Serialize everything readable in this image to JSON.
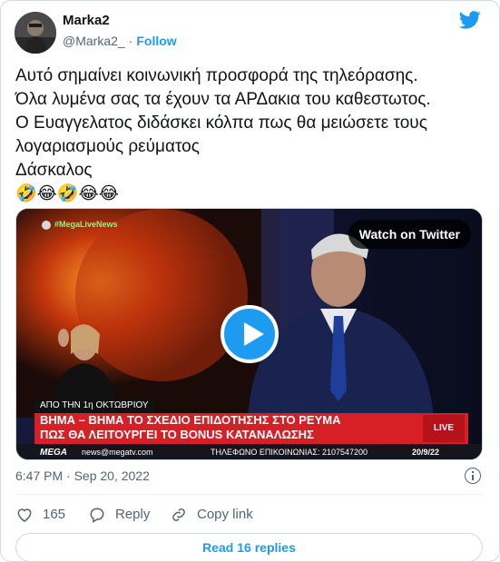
{
  "author": {
    "name": "Marka2",
    "handle": "@Marka2_",
    "follow_label": "Follow"
  },
  "tweet": {
    "lines": [
      "Αυτό σημαίνει κοινωνική προσφορά της τηλεόρασης.",
      "Όλα λυμένα σας τα έχουν τα ΑΡΔακια του καθεστωτος.",
      "Ο Ευαγγελατος διδάσκει κόλπα πως θα μειώσετε τους",
      "λογαριασμούς ρεύματος",
      "Δάσκαλος"
    ],
    "emojis": "🤣😂🤣😂😂"
  },
  "media": {
    "watch_label": "Watch on Twitter",
    "channel_tag": "#MegaLiveNews",
    "ticker_date": "ΑΠΟ ΤΗΝ 1η ΟΚΤΩΒΡΙΟΥ",
    "ticker_line1": "ΒΗΜΑ – ΒΗΜΑ ΤΟ ΣΧΕΔΙΟ ΕΠΙΔΟΤΗΣΗΣ ΣΤΟ ΡΕΥΜΑ",
    "ticker_line2": "ΠΩΣ ΘΑ ΛΕΙΤΟΥΡΓΕΙ ΤΟ BONUS ΚΑΤΑΝΑΛΩΣΗΣ",
    "badge": "LIVE NEWS",
    "footer_brand": "MEGA",
    "footer_site": "news@megatv.com",
    "footer_phone": "ΤΗΛΕΦΩΝΟ ΕΠΙΚΟΙΝΩΝΙΑΣ: 2107547200",
    "footer_time": "20/9/22"
  },
  "meta": {
    "timestamp": "6:47 PM · Sep 20, 2022"
  },
  "actions": {
    "likes": "165",
    "reply_label": "Reply",
    "copy_label": "Copy link"
  },
  "read_replies_label": "Read 16 replies",
  "colors": {
    "accent": "#1d9bf0",
    "secondary_text": "#536471",
    "ticker_red": "#d61f26"
  },
  "icons": [
    "twitter-bird-icon",
    "heart-icon",
    "reply-icon",
    "copy-link-icon",
    "info-icon",
    "play-icon"
  ]
}
